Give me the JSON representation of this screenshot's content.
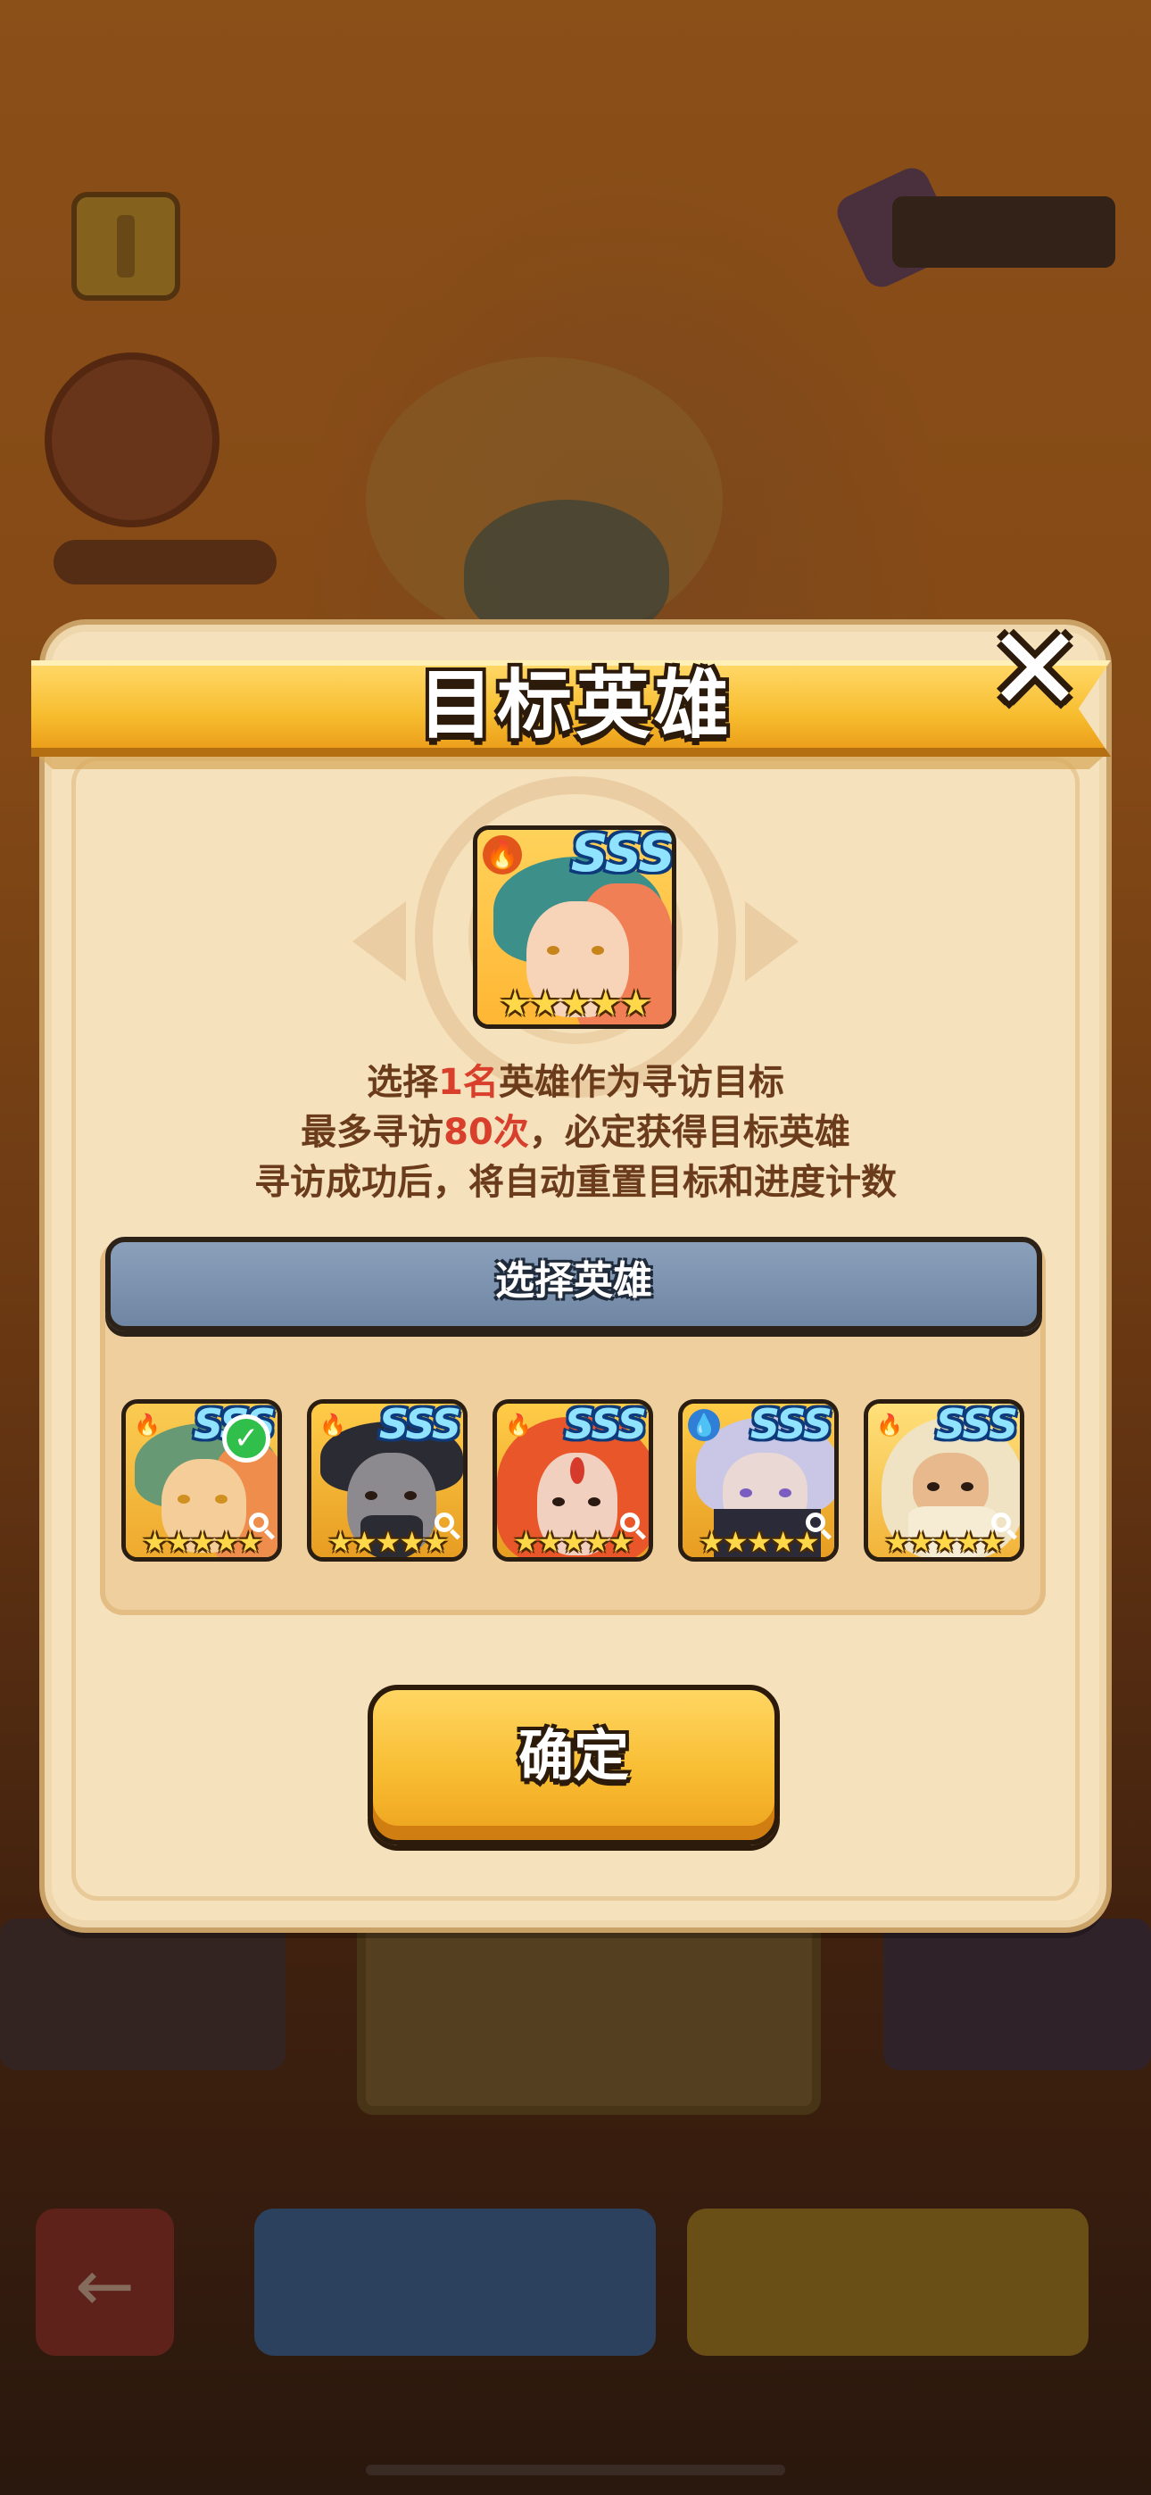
{
  "dialog": {
    "title": "目标英雄",
    "target_hero": {
      "grade": "SSS",
      "element_icon": "fire-icon",
      "stars": 5
    },
    "description": {
      "line1_prefix": "选择",
      "line1_highlight": "1名",
      "line1_suffix": "英雄作为寻访目标",
      "line2_prefix": "最多寻访",
      "line2_highlight": "80次",
      "line2_suffix": "，必定获得目标英雄",
      "line3": "寻访成功后，将自动重置目标和进度计数"
    },
    "select_header": "选择英雄",
    "heroes": [
      {
        "grade": "SSS",
        "element_icon": "fire-icon",
        "stars": 5,
        "selected": true
      },
      {
        "grade": "SSS",
        "element_icon": "fire-icon",
        "stars": 5,
        "selected": false
      },
      {
        "grade": "SSS",
        "element_icon": "fire-icon",
        "stars": 5,
        "selected": false
      },
      {
        "grade": "SSS",
        "element_icon": "water-drop-icon",
        "stars": 5,
        "selected": false
      },
      {
        "grade": "SSS",
        "element_icon": "fire-icon",
        "stars": 5,
        "selected": false
      }
    ],
    "confirm_label": "确定"
  },
  "stars_glyph": "★★★★★",
  "colors": {
    "highlight": "#d9402c",
    "title_ribbon": "#f7bd2f",
    "header_bar": "#7a8fab",
    "confirm_button": "#f8bd32",
    "selected_check": "#2fbf4a"
  }
}
